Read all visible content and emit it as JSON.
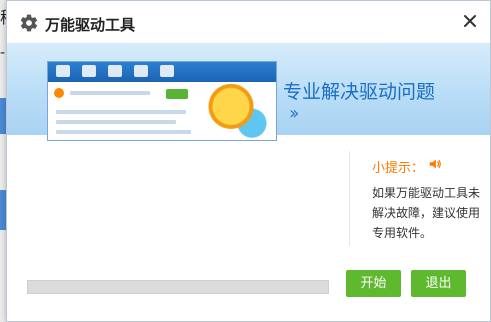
{
  "background_app": {
    "title_fragment": "秘",
    "text_fragment": "- 导"
  },
  "dialog": {
    "title": "万能驱动工具",
    "icons": {
      "logo": "gear-icon",
      "close": "close-icon",
      "chevrons": "double-chevron-right-icon",
      "speaker": "speaker-icon"
    },
    "banner": {
      "heading": "专业解决驱动问题",
      "chevrons": "››"
    },
    "tip": {
      "title": "小提示：",
      "body": "如果万能驱动工具未解决故障，建议使用专用软件。"
    },
    "progress": {
      "value": 0
    },
    "buttons": {
      "start": "开始",
      "exit": "退出"
    },
    "colors": {
      "accent_blue": "#1a6ec4",
      "tip_orange": "#ff7a00",
      "button_green": "#5fb92e"
    }
  }
}
